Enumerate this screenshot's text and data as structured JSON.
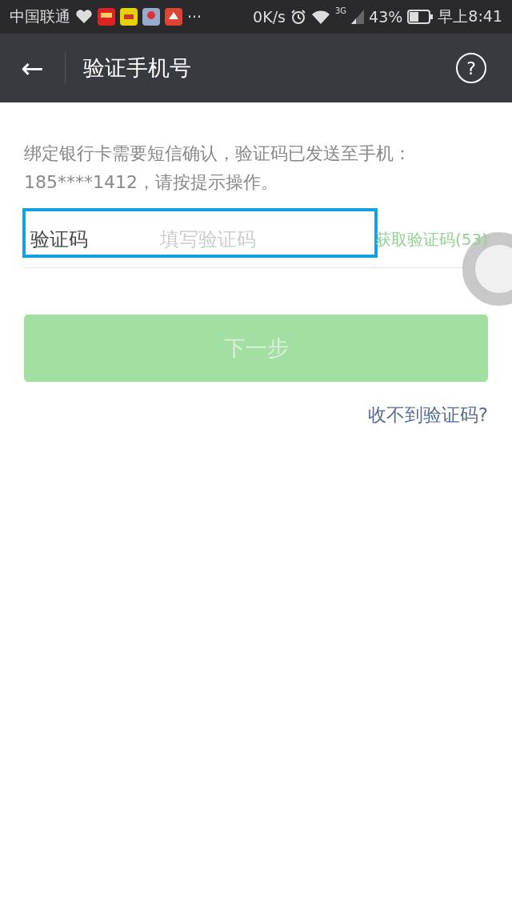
{
  "status_bar": {
    "carrier": "中国联通",
    "more": "···",
    "speed": "0K/s",
    "network": "3G",
    "battery": "43%",
    "time": "早上8:41"
  },
  "header": {
    "back": "←",
    "title": "验证手机号",
    "help": "?"
  },
  "message": "绑定银行卡需要短信确认，验证码已发送至手机：185****1412，请按提示操作。",
  "code_field": {
    "label": "验证码",
    "placeholder": "填写验证码",
    "resend": "获取验证码(53)",
    "highlighted": true
  },
  "next_button": {
    "label": "下一步",
    "disabled": true
  },
  "help_link": "收不到验证码?"
}
